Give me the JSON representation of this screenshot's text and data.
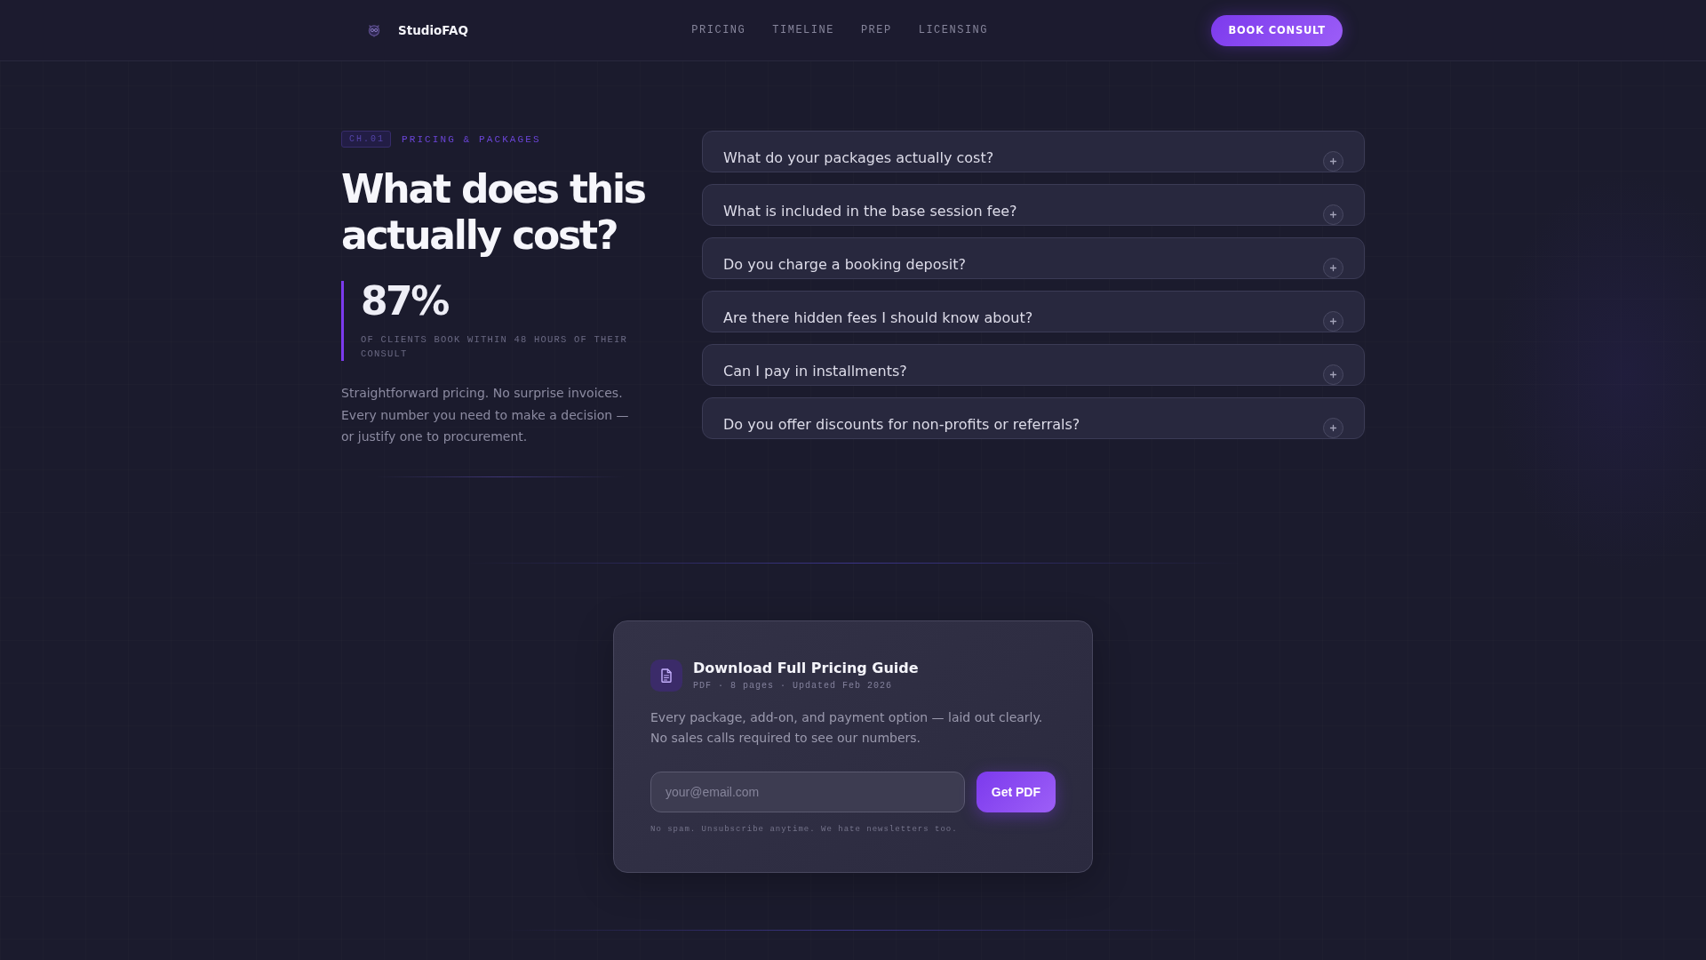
{
  "header": {
    "brand": "StudioFAQ",
    "nav": [
      {
        "label": "PRICING"
      },
      {
        "label": "TIMELINE"
      },
      {
        "label": "PREP"
      },
      {
        "label": "LICENSING"
      }
    ],
    "cta": "BOOK CONSULT"
  },
  "hero": {
    "chapter": "CH.01",
    "eyebrow": "PRICING & PACKAGES",
    "title": "What does this actually cost?",
    "stat": {
      "value": "87%",
      "label": "OF CLIENTS BOOK WITHIN 48 HOURS OF THEIR CONSULT"
    },
    "intro": "Straightforward pricing. No surprise invoices. Every number you need to make a decision — or justify one to procurement."
  },
  "faq": [
    {
      "question": "What do your packages actually cost?",
      "expanded": false
    },
    {
      "question": "What is included in the base session fee?",
      "expanded": false
    },
    {
      "question": "Do you charge a booking deposit?",
      "expanded": false
    },
    {
      "question": "Are there hidden fees I should know about?",
      "expanded": false
    },
    {
      "question": "Can I pay in installments?",
      "expanded": false
    },
    {
      "question": "Do you offer discounts for non-profits or referrals?",
      "expanded": false
    }
  ],
  "download_card": {
    "title": "Download Full Pricing Guide",
    "meta": "PDF · 8 pages · Updated Feb 2026",
    "description": "Every package, add-on, and payment option — laid out clearly. No sales calls required to see our numbers.",
    "email": {
      "placeholder": "your@email.com"
    },
    "button": "Get PDF",
    "note": "No spam. Unsubscribe anytime. We hate newsletters too."
  }
}
